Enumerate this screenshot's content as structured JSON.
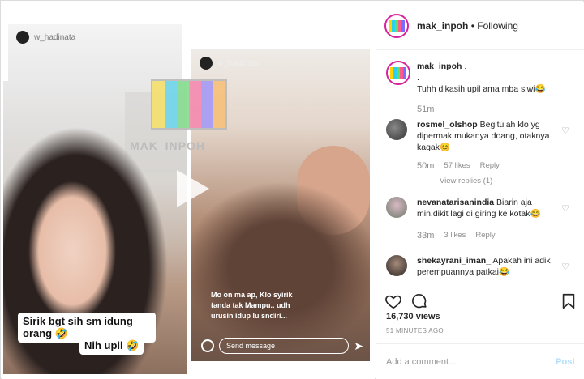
{
  "header": {
    "username": "mak_inpoh",
    "separator": " • ",
    "follow_status": "Following"
  },
  "logo_colors": [
    "#ffd400",
    "#2bd1f5",
    "#5de06b",
    "#ff5a8e",
    "#7a6cff",
    "#ffb347"
  ],
  "media": {
    "story_user_left": "w_hadinata",
    "story_user_right": "w_hadinata",
    "watermark": "MAK_INPOH",
    "caption_1": "Sirik bgt sih sm idung orang 🤣",
    "caption_2": "Nih upil 🤣",
    "overlay_text": "Mo on ma ap, Klo syirik tanda tak Mampu.. udh urusin idup lu sndiri...",
    "send_placeholder": "Send message"
  },
  "caption": {
    "username": "mak_inpoh",
    "text_line1": ".",
    "text_line2": ".",
    "text_line3": "Tuhh dikasih upil ama mba siwi😂",
    "time": "51m"
  },
  "comments": [
    {
      "username": "rosmel_olshop",
      "text": "Begitulah klo yg dipermak mukanya doang, otaknya kagak😊",
      "time": "50m",
      "likes": "57 likes",
      "reply": "Reply",
      "view_replies": "View replies (1)"
    },
    {
      "username": "nevanatarisanindia",
      "text": "Biarin aja min.dikit lagi di giring ke kotak😂",
      "time": "33m",
      "likes": "3 likes",
      "reply": "Reply"
    },
    {
      "username": "shekayrani_iman_",
      "text": "Apakah ini adik perempuannya patkai😂"
    }
  ],
  "stats": {
    "views": "16,730 views",
    "posted": "51 MINUTES AGO"
  },
  "add_comment": {
    "placeholder": "Add a comment...",
    "post_label": "Post"
  }
}
